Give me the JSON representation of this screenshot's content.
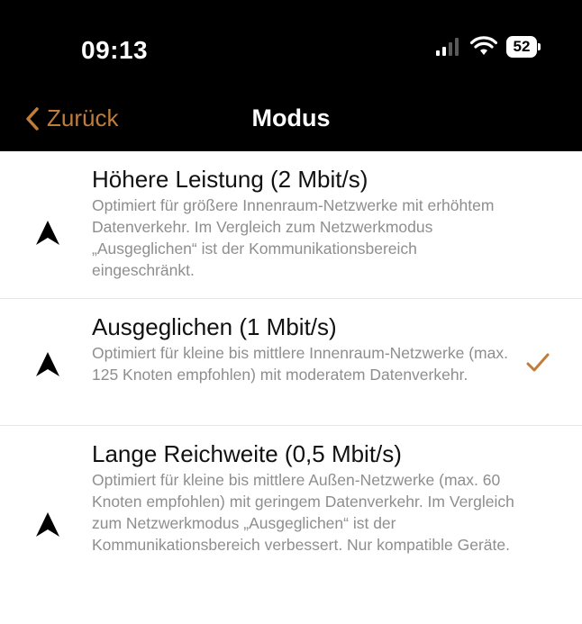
{
  "status": {
    "time": "09:13",
    "battery": "52"
  },
  "nav": {
    "back_label": "Zurück",
    "title": "Modus"
  },
  "colors": {
    "accent": "#c07d3a",
    "background": "#ffffff",
    "topbar": "#000000"
  },
  "modes": [
    {
      "title": "Höhere Leistung (2 Mbit/s)",
      "description": "Optimiert für größere Innenraum-Netzwerke mit erhöhtem Datenverkehr. Im Vergleich zum Netzwerkmodus „Ausgeglichen“ ist der Kommunikationsbereich eingeschränkt.",
      "icon": "arrow-up-icon",
      "selected": false
    },
    {
      "title": "Ausgeglichen (1 Mbit/s)",
      "description": "Optimiert für kleine bis mittlere Innenraum-Netzwerke (max. 125 Knoten empfohlen) mit moderatem Datenverkehr.",
      "icon": "arrow-up-icon",
      "selected": true
    },
    {
      "title": "Lange Reichweite (0,5 Mbit/s)",
      "description": "Optimiert für kleine bis mittlere Außen-Netzwerke (max. 60 Knoten empfohlen) mit geringem Datenverkehr. Im Vergleich zum Netzwerkmodus „Ausgeglichen“ ist der Kommunikationsbereich verbessert. Nur kompatible Geräte.",
      "icon": "arrow-up-icon",
      "selected": false
    }
  ]
}
